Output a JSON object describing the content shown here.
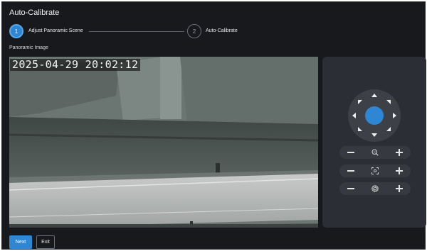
{
  "dialog": {
    "title": "Auto-Calibrate"
  },
  "stepper": {
    "steps": [
      {
        "number": "1",
        "label": "Adjust Panoramic Scene",
        "state": "active"
      },
      {
        "number": "2",
        "label": "Auto-Calibrate",
        "state": "inactive"
      }
    ]
  },
  "panorama": {
    "section_label": "Panoramic Image",
    "osd_timestamp": "2025-04-29 20:02:12"
  },
  "ptz": {
    "directions": [
      "up",
      "down",
      "left",
      "right",
      "up-left",
      "up-right",
      "down-left",
      "down-right"
    ],
    "rows": [
      {
        "name": "zoom",
        "icon": "zoom-icon"
      },
      {
        "name": "focus",
        "icon": "focus-icon"
      },
      {
        "name": "iris",
        "icon": "iris-icon"
      }
    ]
  },
  "footer": {
    "next_label": "Next",
    "exit_label": "Exit"
  },
  "colors": {
    "accent": "#2f87d4",
    "background": "#17191d",
    "panel": "#2b2e34"
  }
}
